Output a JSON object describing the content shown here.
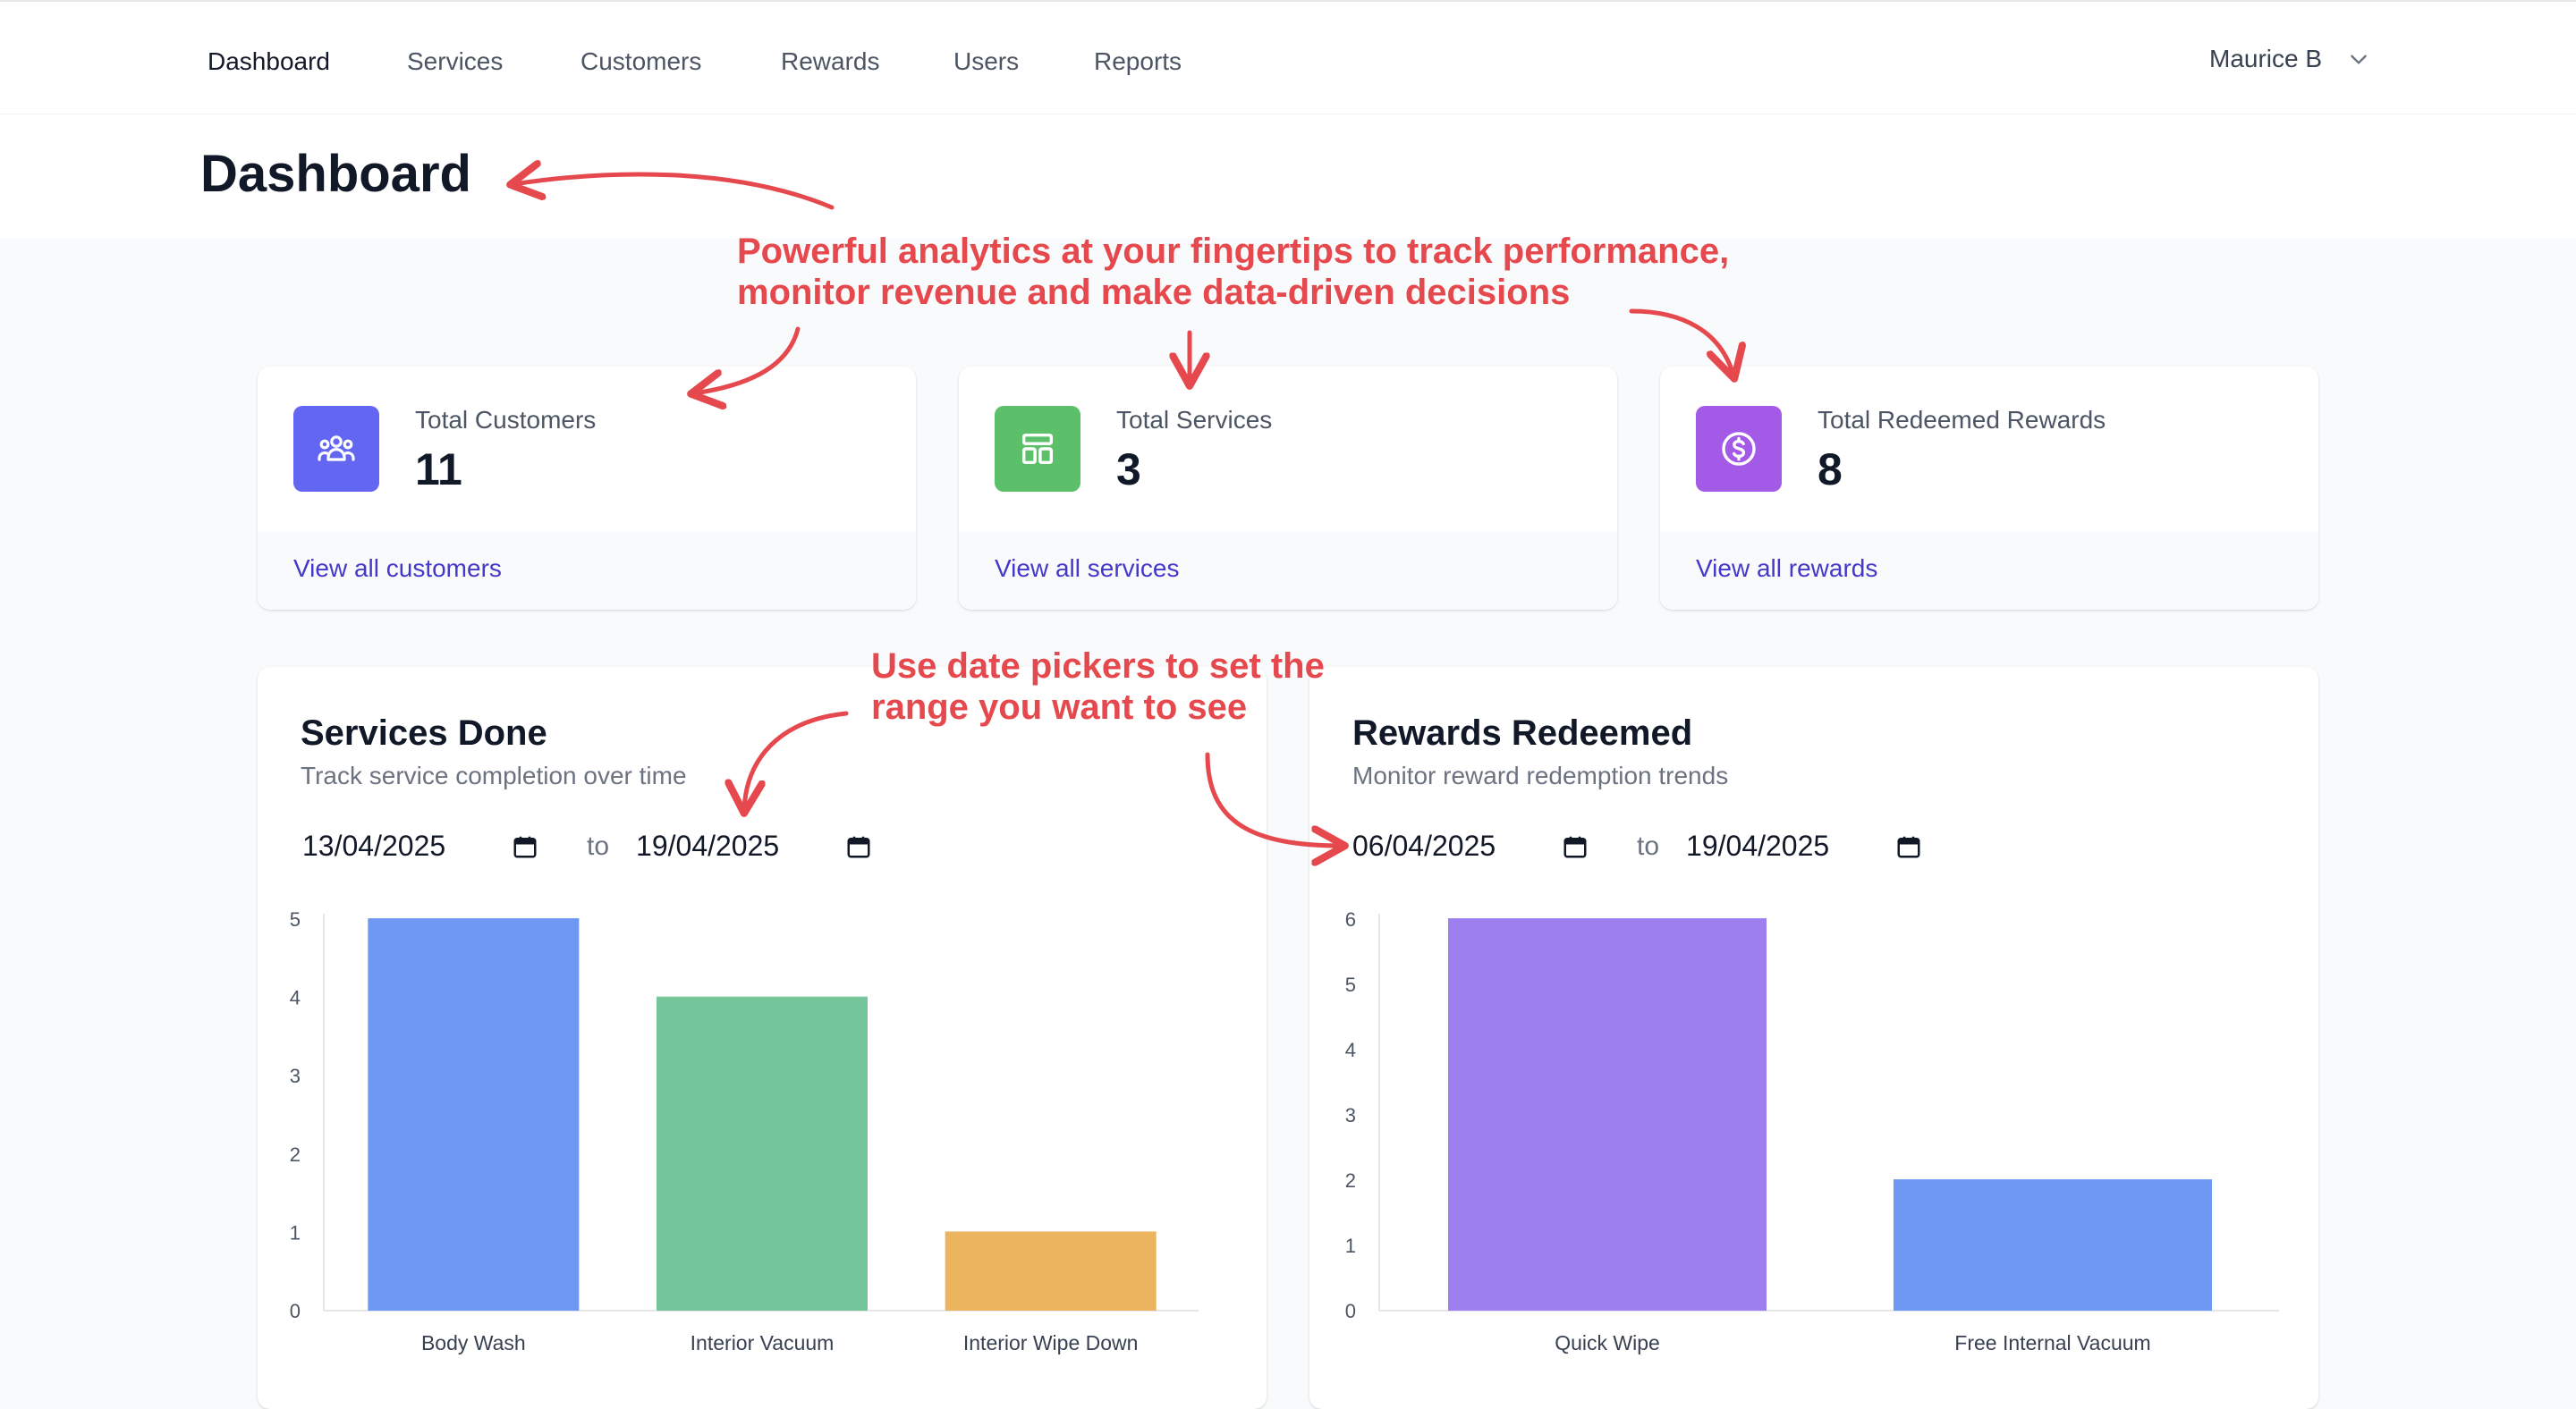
{
  "nav": {
    "items": [
      "Dashboard",
      "Services",
      "Customers",
      "Rewards",
      "Users",
      "Reports"
    ],
    "active": "Dashboard",
    "user_name": "Maurice B"
  },
  "page": {
    "title": "Dashboard"
  },
  "stats": [
    {
      "label": "Total Customers",
      "value": "11",
      "link": "View all customers",
      "icon": "users-icon",
      "color": "#6366f1"
    },
    {
      "label": "Total Services",
      "value": "3",
      "link": "View all services",
      "icon": "layout-icon",
      "color": "#5cc06a"
    },
    {
      "label": "Total Redeemed Rewards",
      "value": "8",
      "link": "View all rewards",
      "icon": "dollar-circle-icon",
      "color": "#a35ae6"
    }
  ],
  "services_chart": {
    "title": "Services Done",
    "subtitle": "Track service completion over time",
    "date_from": "13/04/2025",
    "to_label": "to",
    "date_to": "19/04/2025"
  },
  "rewards_chart": {
    "title": "Rewards Redeemed",
    "subtitle": "Monitor reward redemption trends",
    "date_from": "06/04/2025",
    "to_label": "to",
    "date_to": "19/04/2025"
  },
  "annotations": {
    "analytics_line1": "Powerful analytics at your fingertips to track performance,",
    "analytics_line2": "monitor revenue and make data-driven decisions",
    "datepicker_line1": "Use date pickers to set the",
    "datepicker_line2": "range you want to see",
    "color": "#e5484d"
  },
  "chart_data": [
    {
      "type": "bar",
      "categories": [
        "Body Wash",
        "Interior Vacuum",
        "Interior Wipe Down"
      ],
      "values": [
        5,
        4,
        1
      ],
      "colors": [
        "#6f98f2",
        "#74c69a",
        "#ebb45e"
      ],
      "ylim": [
        0,
        5
      ],
      "yticks": [
        0,
        1,
        2,
        3,
        4,
        5
      ]
    },
    {
      "type": "bar",
      "categories": [
        "Quick Wipe",
        "Free Internal Vacuum"
      ],
      "values": [
        6,
        2
      ],
      "colors": [
        "#9d7ff0",
        "#6f98f2"
      ],
      "ylim": [
        0,
        6
      ],
      "yticks": [
        0,
        1,
        2,
        3,
        4,
        5,
        6
      ]
    }
  ]
}
